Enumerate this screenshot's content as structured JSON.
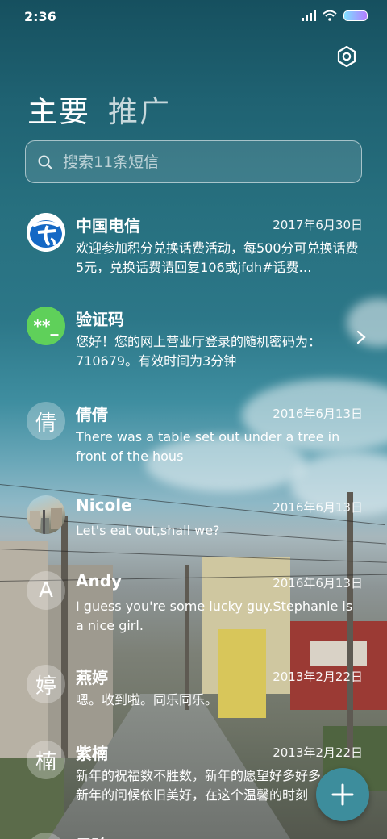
{
  "status": {
    "time": "2:36"
  },
  "tabs": [
    {
      "label": "主要"
    },
    {
      "label": "推广"
    }
  ],
  "search": {
    "placeholder": "搜索11条短信"
  },
  "messages": [
    {
      "name": "中国电信",
      "date": "2017年6月30日",
      "preview": "欢迎参加积分兑换话费活动，每500分可兑换话费5元，兑换话费请回复106或jfdh#话费…",
      "avatar": "china-telecom-logo"
    },
    {
      "name": "验证码",
      "date": "",
      "preview": "您好！您的网上营业厅登录的随机密码为：710679。有效时间为3分钟",
      "avatar_text": "**_"
    },
    {
      "name": "倩倩",
      "date": "2016年6月13日",
      "preview": "There was a table set out under a tree in front of the hous",
      "avatar_text": "倩"
    },
    {
      "name": "Nicole",
      "date": "2016年6月13日",
      "preview": "Let's eat out,shall we?",
      "avatar": "photo"
    },
    {
      "name": "Andy",
      "date": "2016年6月13日",
      "preview": "I guess you're some lucky guy.Stephanie is a nice girl.",
      "avatar_text": "A"
    },
    {
      "name": "燕婷",
      "date": "2013年2月22日",
      "preview": "嗯。收到啦。同乐同乐。",
      "avatar_text": "婷"
    },
    {
      "name": "紫楠",
      "date": "2013年2月22日",
      "preview": "新年的祝福数不胜数，新年的愿望好多好多，新年的问候依旧美好，在这个温馨的时刻",
      "avatar_text": "楠"
    },
    {
      "name": "子玲",
      "date": "",
      "preview": "",
      "avatar_text": ""
    }
  ],
  "colors": {
    "verify_avatar": "#5fd05a",
    "fab": "#3d8d9c",
    "telecom_blue": "#1468c5"
  },
  "icons": {
    "settings": "gear-icon",
    "search": "search-icon",
    "fab": "plus-icon",
    "chevron": "chevron-right-icon"
  }
}
